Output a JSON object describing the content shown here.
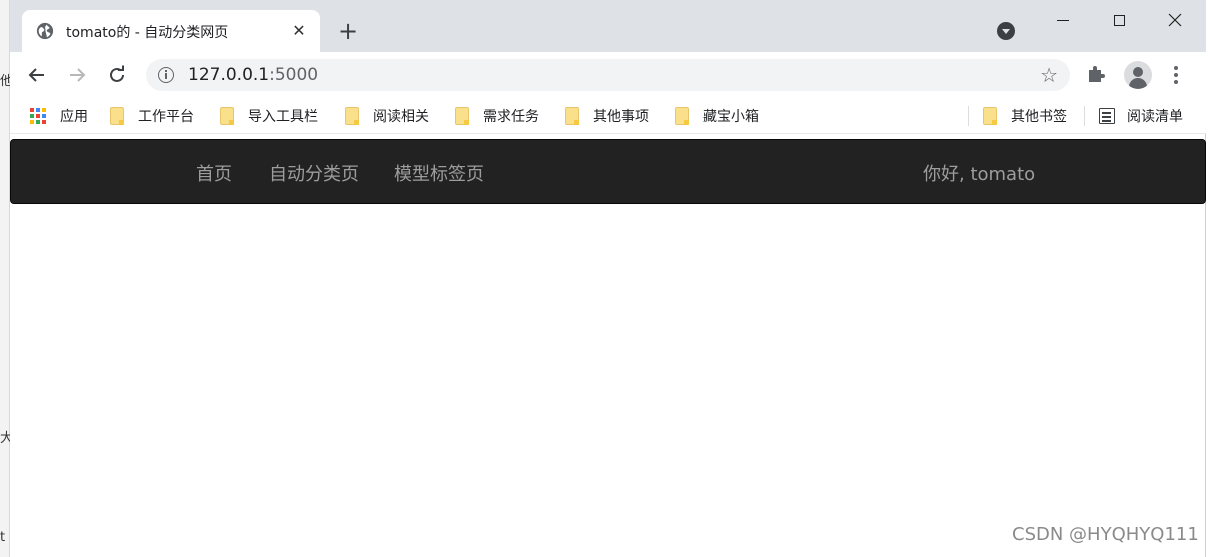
{
  "browser": {
    "tab_title": "tomato的 - 自动分类网页",
    "url_host": "127.0.0.1",
    "url_port": ":5000",
    "bookmarks": [
      {
        "label": "应用"
      },
      {
        "label": "工作平台"
      },
      {
        "label": "导入工具栏"
      },
      {
        "label": "阅读相关"
      },
      {
        "label": "需求任务"
      },
      {
        "label": "其他事项"
      },
      {
        "label": "藏宝小箱"
      }
    ],
    "other_bookmarks": "其他书签",
    "reading_list": "阅读清单"
  },
  "navbar": {
    "links": [
      "首页",
      "自动分类页",
      "模型标签页"
    ],
    "greeting": "你好, tomato"
  },
  "watermark": "CSDN @HYQHYQ111",
  "background_window_fragments": [
    "他",
    "大",
    "t"
  ],
  "colors": {
    "navbar_bg": "#222222",
    "nav_text": "#9d9d9d",
    "tabstrip_bg": "#dee1e6",
    "folder_yellow": "#fbe08c"
  },
  "icons": [
    "globe-icon",
    "close-icon",
    "plus-icon",
    "back-arrow-icon",
    "forward-arrow-icon",
    "reload-icon",
    "info-icon",
    "star-icon",
    "puzzle-icon",
    "profile-icon",
    "menu-dots-icon",
    "apps-grid-icon",
    "folder-icon",
    "reading-list-icon"
  ]
}
